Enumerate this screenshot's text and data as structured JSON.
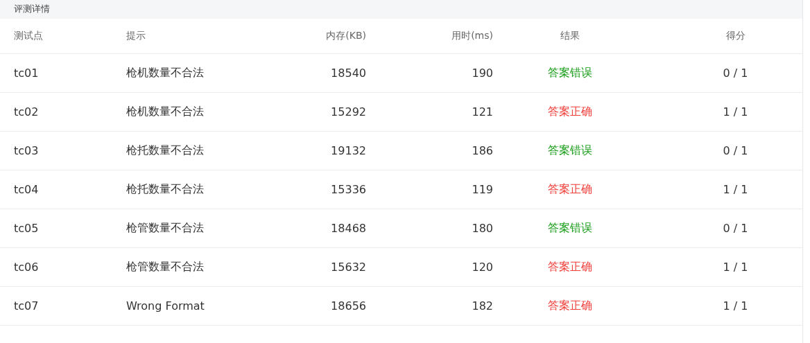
{
  "title": "评测详情",
  "table": {
    "columns": [
      "测试点",
      "提示",
      "内存(KB)",
      "用时(ms)",
      "结果",
      "得分"
    ],
    "rows": [
      {
        "case": "tc01",
        "hint": "枪机数量不合法",
        "memory": "18540",
        "time": "190",
        "result": "答案错误",
        "color": "#1a9e1a",
        "score": "0 / 1"
      },
      {
        "case": "tc02",
        "hint": "枪机数量不合法",
        "memory": "15292",
        "time": "121",
        "result": "答案正确",
        "color": "#f2403a",
        "score": "1 / 1"
      },
      {
        "case": "tc03",
        "hint": "枪托数量不合法",
        "memory": "19132",
        "time": "186",
        "result": "答案错误",
        "color": "#1a9e1a",
        "score": "0 / 1"
      },
      {
        "case": "tc04",
        "hint": "枪托数量不合法",
        "memory": "15336",
        "time": "119",
        "result": "答案正确",
        "color": "#f2403a",
        "score": "1 / 1"
      },
      {
        "case": "tc05",
        "hint": "枪管数量不合法",
        "memory": "18468",
        "time": "180",
        "result": "答案错误",
        "color": "#1a9e1a",
        "score": "0 / 1"
      },
      {
        "case": "tc06",
        "hint": "枪管数量不合法",
        "memory": "15632",
        "time": "120",
        "result": "答案正确",
        "color": "#f2403a",
        "score": "1 / 1"
      },
      {
        "case": "tc07",
        "hint": "Wrong Format",
        "memory": "18656",
        "time": "182",
        "result": "答案正确",
        "color": "#f2403a",
        "score": "1 / 1"
      }
    ]
  }
}
